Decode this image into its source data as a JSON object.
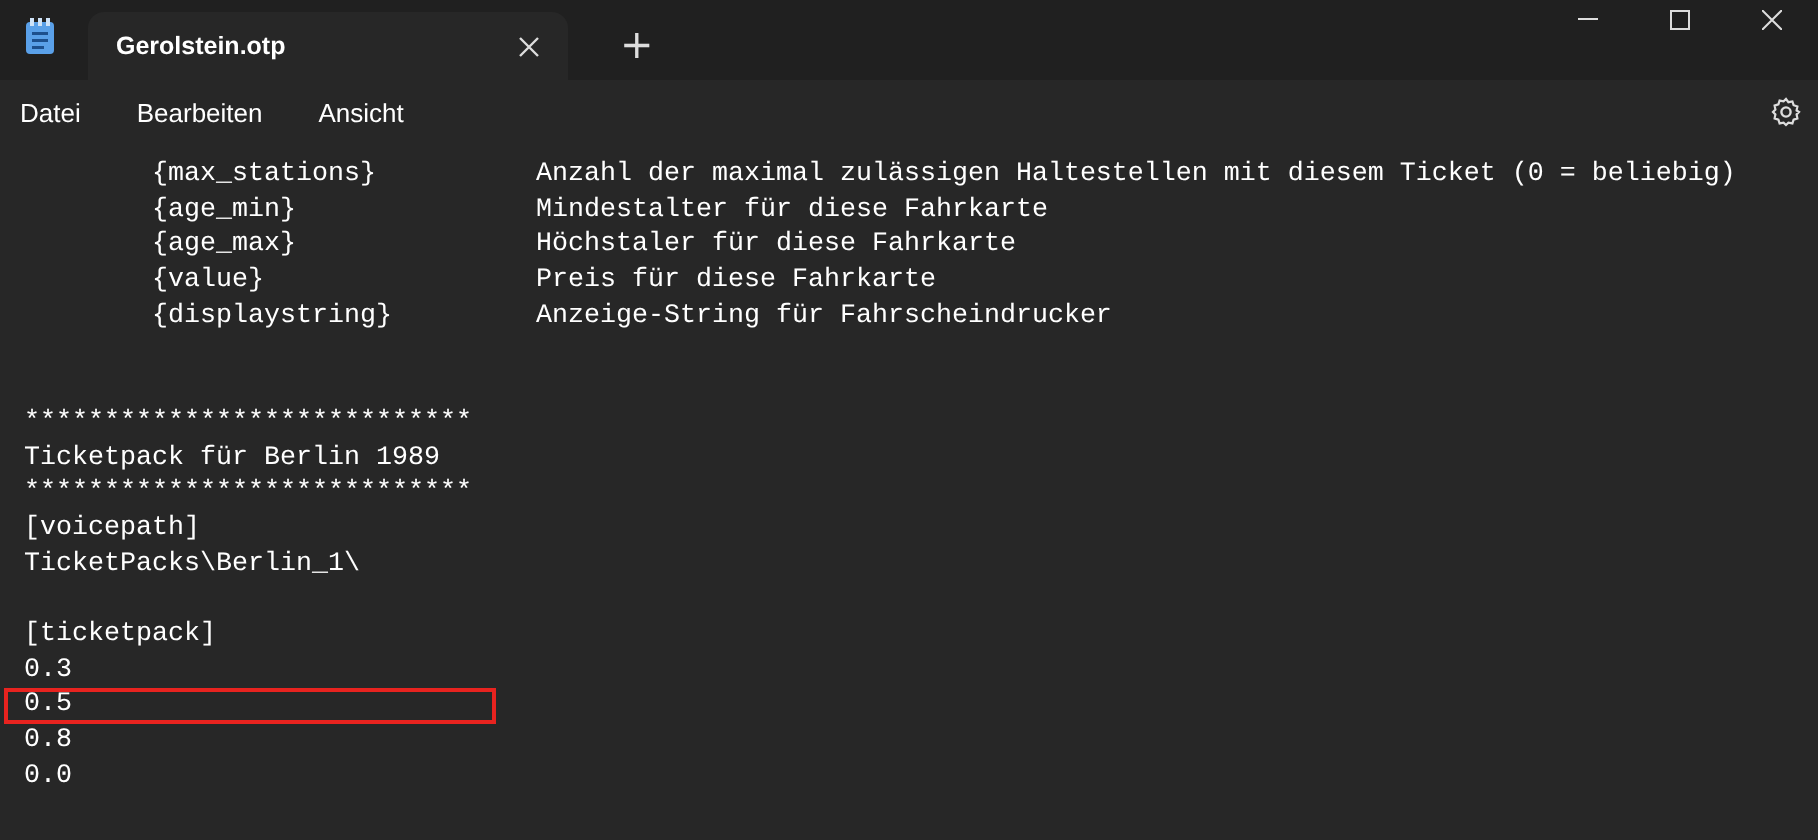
{
  "window": {
    "title": "Gerolstein.otp",
    "new_tab": "+"
  },
  "menu": [
    {
      "label": "Datei"
    },
    {
      "label": "Bearbeiten"
    },
    {
      "label": "Ansicht"
    }
  ],
  "editor": {
    "lines": [
      {
        "kind": "entry",
        "key": "{max_stations}",
        "description": "Anzahl der maximal zulässigen Haltestellen mit diesem Ticket (0 = beliebig)"
      },
      {
        "kind": "entry",
        "key": "{age_min}",
        "description": "Mindestalter für diese Fahrkarte"
      },
      {
        "kind": "entry",
        "key": "{age_max}",
        "description": "Höchstaler für diese Fahrkarte"
      },
      {
        "kind": "entry",
        "key": "{value}",
        "description": "Preis für diese Fahrkarte"
      },
      {
        "kind": "entry",
        "key": "{displaystring}",
        "description": "Anzeige-String für Fahrscheindrucker"
      },
      {
        "kind": "blank"
      },
      {
        "kind": "blank"
      },
      {
        "kind": "text",
        "text": "****************************",
        "highlighted": false
      },
      {
        "kind": "text",
        "text": "Ticketpack für Berlin 1989",
        "highlighted": false
      },
      {
        "kind": "text",
        "text": "****************************",
        "highlighted": false
      },
      {
        "kind": "text",
        "text": "[voicepath]",
        "highlighted": false
      },
      {
        "kind": "text",
        "text": "TicketPacks\\Berlin_1\\",
        "highlighted": false
      },
      {
        "kind": "blank"
      },
      {
        "kind": "text",
        "text": "[ticketpack]",
        "highlighted": false
      },
      {
        "kind": "text",
        "text": "0.3",
        "highlighted": false
      },
      {
        "kind": "text",
        "text": "0.5",
        "highlighted": true
      },
      {
        "kind": "text",
        "text": "0.8",
        "highlighted": false
      },
      {
        "kind": "text",
        "text": "0.0",
        "highlighted": false
      }
    ]
  }
}
